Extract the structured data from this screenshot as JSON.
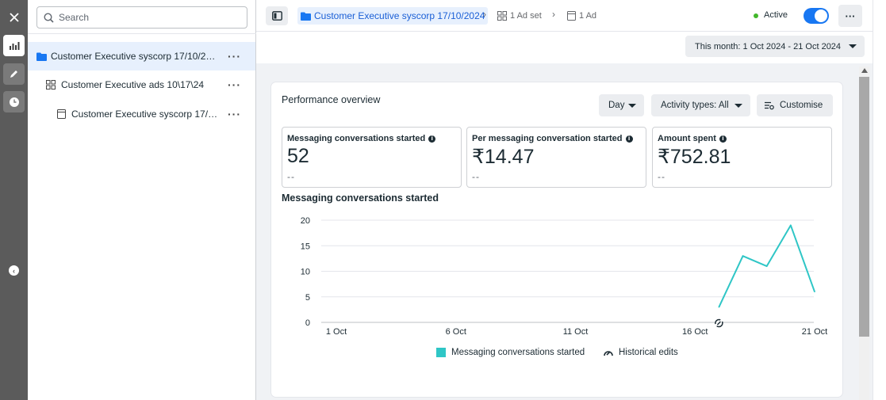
{
  "rail": {
    "close_icon": "close-icon",
    "items": [
      {
        "icon": "bar-chart-icon",
        "active": true
      },
      {
        "icon": "pencil-icon",
        "active": false
      },
      {
        "icon": "clock-icon",
        "active": false
      }
    ],
    "collapse_icon": "chevron-left-icon"
  },
  "tree": {
    "search_placeholder": "Search",
    "items": [
      {
        "label": "Customer Executive syscorp 17/10/2024",
        "type": "campaign",
        "icon": "folder-icon",
        "selected": true
      },
      {
        "label": "Customer Executive ads 10\\17\\24",
        "type": "adset",
        "icon": "grid-icon",
        "selected": false
      },
      {
        "label": "Customer Executive syscorp 17/10/...",
        "type": "ad",
        "icon": "ad-icon",
        "selected": false
      }
    ]
  },
  "topbar": {
    "campaign": "Customer Executive syscorp 17/10/2024",
    "adset": "1 Ad set",
    "ad": "1 Ad",
    "status": "Active",
    "status_color": "#42b72a",
    "toggle_on": true,
    "more": "···"
  },
  "date_range": "This month: 1 Oct 2024 - 21 Oct 2024",
  "overview": {
    "title": "Performance overview",
    "day_label": "Day",
    "activity_label": "Activity types: All",
    "customise_label": "Customise",
    "metrics": [
      {
        "label": "Messaging conversations started",
        "value": "52",
        "delta": "--"
      },
      {
        "label": "Per messaging conversation started",
        "value": "₹14.47",
        "delta": "--"
      },
      {
        "label": "Amount spent",
        "value": "₹752.81",
        "delta": "--"
      }
    ]
  },
  "chart_data": {
    "type": "line",
    "title": "Messaging conversations started",
    "xlabel": "",
    "ylabel": "",
    "ylim": [
      0,
      20
    ],
    "yticks": [
      0,
      5,
      10,
      15,
      20
    ],
    "x_tick_labels": [
      "1 Oct",
      "6 Oct",
      "11 Oct",
      "16 Oct",
      "21 Oct"
    ],
    "x_domain": [
      1,
      21
    ],
    "series": [
      {
        "name": "Messaging conversations started",
        "color": "#2fc6c6",
        "x": [
          17,
          18,
          19,
          20,
          21
        ],
        "values": [
          3,
          13,
          11,
          19,
          6
        ]
      }
    ],
    "edit_markers_x": [
      17
    ],
    "legend": [
      "Messaging conversations started",
      "Historical edits"
    ],
    "legend_position": "bottom",
    "grid": true
  }
}
